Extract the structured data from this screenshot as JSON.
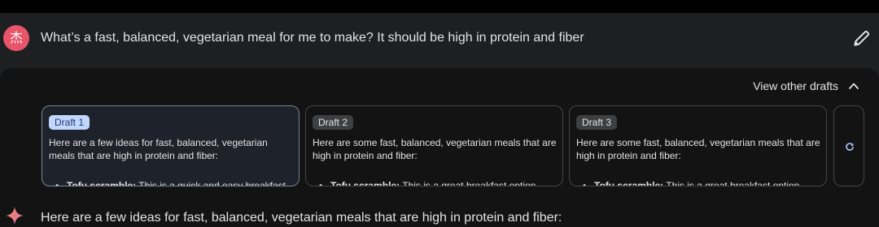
{
  "prompt": {
    "avatar_initial": "杰",
    "text": "What’s a fast, balanced, vegetarian meal for me to make? It should be high in protein and fiber",
    "edit_icon": "pencil-icon"
  },
  "drafts": {
    "toggle_label": "View other drafts",
    "toggle_icon": "chevron-up-icon",
    "items": [
      {
        "label": "Draft 1",
        "text": "Here are a few ideas for fast, balanced, vegetarian meals that are high in protein and fiber:",
        "bullet_title": "Tofu scramble:",
        "bullet_text": " This is a quick and easy breakfast",
        "selected": true
      },
      {
        "label": "Draft 2",
        "text": "Here are some fast, balanced, vegetarian meals that are high in protein and fiber:",
        "bullet_title": "Tofu scramble:",
        "bullet_text": " This is a great breakfast option"
      },
      {
        "label": "Draft 3",
        "text": "Here are some fast, balanced, vegetarian meals that are high in protein and fiber:",
        "bullet_title": "Tofu scramble:",
        "bullet_text": " This is a great breakfast option"
      }
    ],
    "regenerate_icon": "refresh-icon"
  },
  "response": {
    "icon": "sparkle-icon",
    "text": "Here are a few ideas for fast, balanced, vegetarian meals that are high in protein and fiber:"
  },
  "colors": {
    "avatar": "#e8546a",
    "accent_blue": "#a8c7fa",
    "chip_selected": "#c2d7ff"
  }
}
